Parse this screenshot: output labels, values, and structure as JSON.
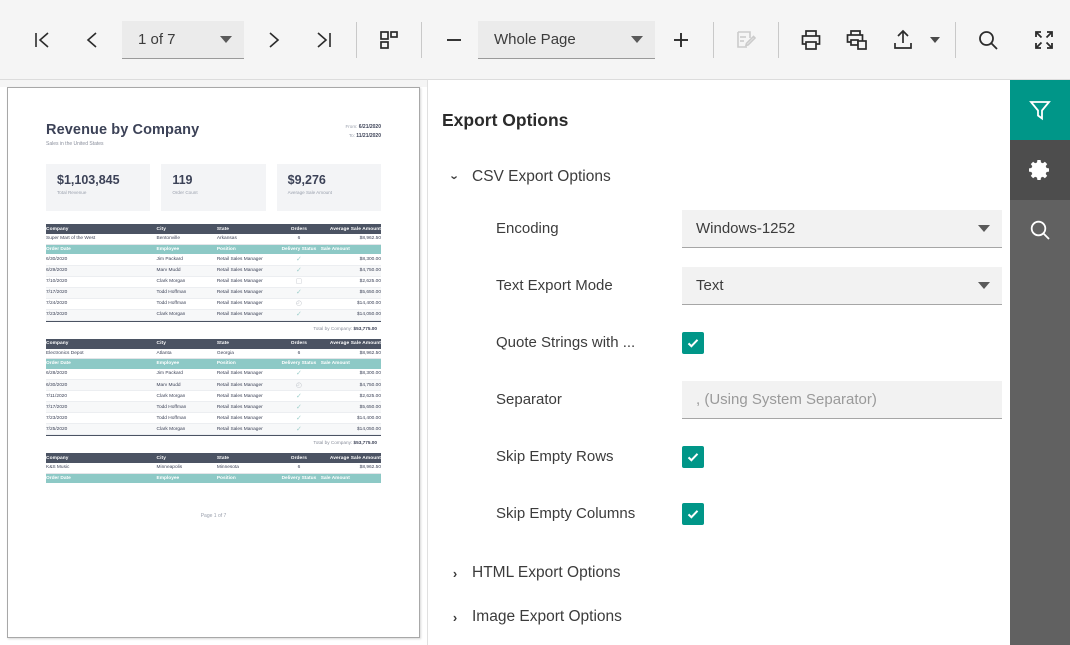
{
  "toolbar": {
    "first_page_icon": "first-page-icon",
    "prev_page_icon": "previous-page-icon",
    "page_selector_value": "1 of 7",
    "next_page_icon": "next-page-icon",
    "last_page_icon": "last-page-icon",
    "multipage_icon": "page-layout-icon",
    "zoom_out_icon": "zoom-out-icon",
    "zoom_value": "Whole Page",
    "zoom_in_icon": "zoom-in-icon",
    "edit_icon": "edit-document-icon",
    "print_icon": "print-icon",
    "print_copies_icon": "print-multiple-icon",
    "export_icon": "export-upload-icon",
    "export_caret_icon": "caret-down-icon",
    "search_icon": "search-icon",
    "fullscreen_icon": "fullscreen-icon"
  },
  "panel": {
    "title": "Export Options",
    "groups": [
      {
        "label": "CSV Export Options",
        "expanded": true,
        "chevron": "chevron-down-icon"
      },
      {
        "label": "HTML Export Options",
        "expanded": false,
        "chevron": "chevron-right-icon"
      },
      {
        "label": "Image Export Options",
        "expanded": false,
        "chevron": "chevron-right-icon"
      }
    ],
    "csv_options": {
      "encoding": {
        "label": "Encoding",
        "value": "Windows-1252",
        "type": "select"
      },
      "text_export_mode": {
        "label": "Text Export Mode",
        "value": "Text",
        "type": "select"
      },
      "quote_strings": {
        "label": "Quote Strings with ...",
        "checked": true,
        "type": "checkbox"
      },
      "separator": {
        "label": "Separator",
        "value": "",
        "placeholder": ", (Using System Separator)",
        "type": "input"
      },
      "skip_empty_rows": {
        "label": "Skip Empty Rows",
        "checked": true,
        "type": "checkbox"
      },
      "skip_empty_columns": {
        "label": "Skip Empty Columns",
        "checked": true,
        "type": "checkbox"
      }
    }
  },
  "rail": {
    "items": [
      {
        "name": "filter-icon",
        "label": "Filter",
        "active": true
      },
      {
        "name": "gear-icon",
        "label": "Settings",
        "active": false
      },
      {
        "name": "search-icon",
        "label": "Search",
        "active": false
      }
    ]
  },
  "report": {
    "title": "Revenue by Company",
    "subtitle": "Sales in the United States",
    "from_label": "From:",
    "from_value": "6/21/2020",
    "to_label": "To:",
    "to_value": "11/21/2020",
    "kpis": [
      {
        "value": "$1,103,845",
        "label": "Total Revenue"
      },
      {
        "value": "119",
        "label": "Order Count"
      },
      {
        "value": "$9,276",
        "label": "Average Sale Amount"
      }
    ],
    "company_headers": [
      "Company",
      "City",
      "State",
      "Orders",
      "Average Sale Amount"
    ],
    "detail_headers": [
      "Order Date",
      "Employee",
      "Position",
      "Delivery Status",
      "Sale Amount"
    ],
    "total_label": "Total by Company:",
    "footer": "Page 1 of 7",
    "blocks": [
      {
        "company": [
          "Super Mart of the West",
          "Bentonville",
          "Arkansas",
          "6",
          "$8,962.50"
        ],
        "rows": [
          {
            "date": "6/30/2020",
            "employee": "Jim Packard",
            "position": "Retail Sales Manager",
            "status": "check",
            "amount": "$8,300.00"
          },
          {
            "date": "6/29/2020",
            "employee": "Marv Mudd",
            "position": "Retail Sales Manager",
            "status": "check",
            "amount": "$4,750.00"
          },
          {
            "date": "7/10/2020",
            "employee": "Clark Morgan",
            "position": "Retail Sales Manager",
            "status": "truck",
            "amount": "$2,625.00"
          },
          {
            "date": "7/17/2020",
            "employee": "Todd Hoffman",
            "position": "Retail Sales Manager",
            "status": "check",
            "amount": "$5,650.00"
          },
          {
            "date": "7/24/2020",
            "employee": "Todd Hoffman",
            "position": "Retail Sales Manager",
            "status": "clock",
            "amount": "$14,400.00"
          },
          {
            "date": "7/23/2020",
            "employee": "Clark Morgan",
            "position": "Retail Sales Manager",
            "status": "check",
            "amount": "$14,050.00"
          }
        ],
        "total": "$53,775.00"
      },
      {
        "company": [
          "Electronics Depot",
          "Atlanta",
          "Georgia",
          "6",
          "$8,962.50"
        ],
        "rows": [
          {
            "date": "6/28/2020",
            "employee": "Jim Packard",
            "position": "Retail Sales Manager",
            "status": "check",
            "amount": "$8,300.00"
          },
          {
            "date": "6/30/2020",
            "employee": "Marv Mudd",
            "position": "Retail Sales Manager",
            "status": "clock",
            "amount": "$4,750.00"
          },
          {
            "date": "7/11/2020",
            "employee": "Clark Morgan",
            "position": "Retail Sales Manager",
            "status": "check",
            "amount": "$2,625.00"
          },
          {
            "date": "7/17/2020",
            "employee": "Todd Hoffman",
            "position": "Retail Sales Manager",
            "status": "check",
            "amount": "$5,650.00"
          },
          {
            "date": "7/23/2020",
            "employee": "Todd Hoffman",
            "position": "Retail Sales Manager",
            "status": "check",
            "amount": "$14,400.00"
          },
          {
            "date": "7/25/2020",
            "employee": "Clark Morgan",
            "position": "Retail Sales Manager",
            "status": "check",
            "amount": "$14,050.00"
          }
        ],
        "total": "$53,775.00"
      },
      {
        "company": [
          "K&S Music",
          "Minneapolis",
          "Minnesota",
          "6",
          "$8,962.50"
        ],
        "rows": [],
        "total": ""
      }
    ]
  },
  "colors": {
    "accent": "#009688",
    "rail_bg": "#616161",
    "rail_dark": "#4d4d4d",
    "toolbar_bg": "#f5f5f5",
    "field_bg": "#f2f2f2",
    "table_header_dark": "#4b5363",
    "table_header_teal": "#8dc9c6"
  }
}
